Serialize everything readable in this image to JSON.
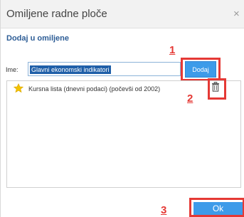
{
  "dialog": {
    "title": "Omiljene radne ploče",
    "close_glyph": "×"
  },
  "section": {
    "title": "Dodaj u omiljene"
  },
  "form": {
    "name_label": "Ime:",
    "name_value": "Glavni ekonomski indikatori",
    "add_label": "Dodaj"
  },
  "favorites": {
    "items": [
      {
        "icon": "star-icon",
        "label": "Kursna lista (dnevni podaci) (počevši od 2002)"
      }
    ],
    "delete_icon": "trash-icon"
  },
  "footer": {
    "ok_label": "Ok"
  },
  "annotations": {
    "markers": [
      "1",
      "2",
      "3"
    ],
    "color": "#e53935"
  },
  "colors": {
    "accent": "#3d9be9",
    "heading": "#2d5d96",
    "selection": "#1f5fa8"
  }
}
